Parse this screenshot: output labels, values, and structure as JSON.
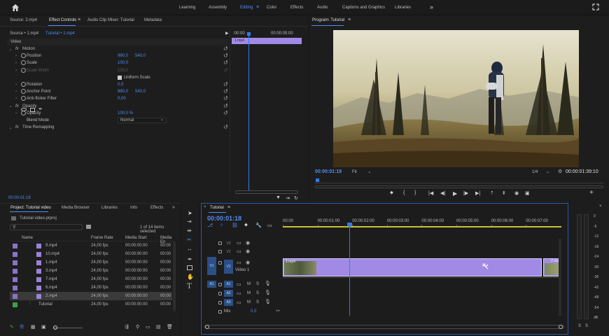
{
  "workspaces": {
    "items": [
      "Learning",
      "Assembly",
      "Editing",
      "Color",
      "Effects",
      "Audio",
      "Captions and Graphics",
      "Libraries"
    ],
    "active": "Editing",
    "more": "»"
  },
  "source_panel": {
    "tabs": [
      "Source: 2.mp4",
      "Effect Controls",
      "Audio Clip Mixer: Tutorial",
      "Metadata"
    ],
    "active_tab": "Effect Controls",
    "menu_glyph": "≡",
    "source_label": "Source • 1.mp4",
    "clip_label": "Tutorial • 1.mp4",
    "section": "Video",
    "timecodes": [
      ":00:00",
      "00:00:05:00"
    ],
    "clip_bar_label": "1.mp4",
    "bottom_timecode": "00:00:01:18",
    "properties": [
      {
        "name": "Motion",
        "fx": true
      },
      {
        "name": "Position",
        "v1": "960,0",
        "v2": "540,0"
      },
      {
        "name": "Scale",
        "v1": "100,0"
      },
      {
        "name": "Scale Width",
        "v1": "100,0",
        "disabled": true
      },
      {
        "name": "Uniform Scale",
        "checkbox": true
      },
      {
        "name": "Rotation",
        "v1": "0,0"
      },
      {
        "name": "Anchor Point",
        "v1": "960,0",
        "v2": "540,0"
      },
      {
        "name": "Anti-flicker Filter",
        "v1": "0,00"
      },
      {
        "name": "Opacity",
        "fx": true
      },
      {
        "name": "Opacity",
        "v1": "100,0 %"
      },
      {
        "name": "Blend Mode",
        "select": "Normal"
      },
      {
        "name": "Time Remapping",
        "fx": true
      }
    ]
  },
  "program": {
    "title": "Program: Tutorial",
    "menu_glyph": "≡",
    "timecode": "00:00:01:18",
    "fit": "Fit",
    "ratio": "1/4",
    "duration": "00:00:01:39:10"
  },
  "project": {
    "tabs": [
      "Project: Tutorial video",
      "Media Browser",
      "Libraries",
      "Info",
      "Effects"
    ],
    "more": "»",
    "file": "Tutorial video.prproj",
    "selection": "1 of 14 items selected",
    "columns": [
      "Name",
      "Frame Rate",
      "Media Start",
      "Media En"
    ],
    "items": [
      {
        "name": "9.mp4",
        "fps": "24,00 fps",
        "start": "00:00:00:00",
        "end": "00:00",
        "color": "#8a72c8",
        "type": "clip"
      },
      {
        "name": "10.mp4",
        "fps": "24,00 fps",
        "start": "00:00:00:00",
        "end": "00:00",
        "color": "#8a72c8",
        "type": "clip"
      },
      {
        "name": "1.mp4",
        "fps": "24,00 fps",
        "start": "00:00:00:00",
        "end": "00:00",
        "color": "#8a72c8",
        "type": "clip"
      },
      {
        "name": "3.mp4",
        "fps": "24,00 fps",
        "start": "00:00:00:00",
        "end": "00:00",
        "color": "#8a72c8",
        "type": "clip"
      },
      {
        "name": "7.mp4",
        "fps": "24,00 fps",
        "start": "00:00:00:00",
        "end": "00:00",
        "color": "#8a72c8",
        "type": "clip"
      },
      {
        "name": "6.mp4",
        "fps": "24,00 fps",
        "start": "00:00:00:00",
        "end": "00:00",
        "color": "#8a72c8",
        "type": "clip"
      },
      {
        "name": "2.mp4",
        "fps": "24,00 fps",
        "start": "00:00:00:00",
        "end": "00:00",
        "color": "#8a72c8",
        "type": "clip",
        "selected": true
      },
      {
        "name": "Tutorial",
        "fps": "24,00 fps",
        "start": "00:00:00:00",
        "end": "00:00",
        "color": "#3aa24e",
        "type": "sequence"
      }
    ]
  },
  "timeline": {
    "title": "Tutorial",
    "menu_glyph": "≡",
    "timecode": "00:00:01:18",
    "ruler": [
      "00:00",
      "00:00:01:00",
      "00:00:02:00",
      "00:00:03:00",
      "00:00:04:00",
      "00:00:05:00",
      "00:00:06:00",
      "00:00:07:00"
    ],
    "video_tracks": [
      "V3",
      "V2",
      "V1"
    ],
    "source_patch_v": "V1",
    "track_name_v1": "Video 1",
    "audio_tracks": [
      "A1",
      "A2",
      "A3"
    ],
    "source_patch_a": "A1",
    "mute": "M",
    "solo": "S",
    "mix_label": "Mix",
    "mix_value": "0,0",
    "clip_label": "1.mp4",
    "clip_label_end": "2.mp4"
  },
  "meter": {
    "scale": [
      "0",
      "-6",
      "-12",
      "-18",
      "-24",
      "-30",
      "-36",
      "-42",
      "-48",
      "-54",
      "dB"
    ],
    "solo": [
      "S",
      "S"
    ]
  },
  "colors": {
    "accent_blue": "#4f8ef7",
    "clip_purple": "#a08ae6",
    "sequence_green": "#3aa24e",
    "playhead_blue": "#2e7cf0"
  }
}
